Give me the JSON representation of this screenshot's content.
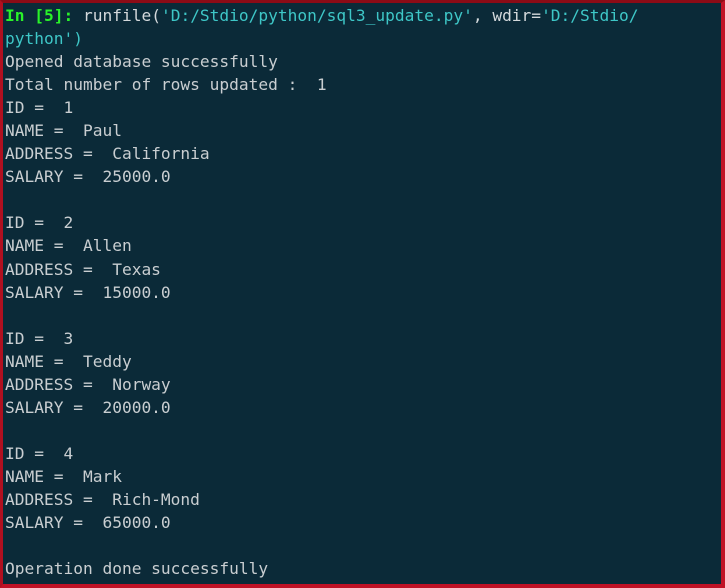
{
  "window": {
    "kind": "ipython-console",
    "background_color": "#0b2a38",
    "border_color": "#c01226",
    "output_text_color": "#c9ced1",
    "string_color": "#3ec7c7",
    "prompt_color": "#29f329",
    "code_color": "#d4d9dc"
  },
  "prompt": {
    "label_in": "In",
    "label_number": "[5]:",
    "full": "In [5]:"
  },
  "lines": [
    {
      "id": "line-input-1",
      "type": "input",
      "segments": [
        {
          "text": "In ",
          "color": "prompt"
        },
        {
          "text": "[5]:",
          "color": "prompt"
        },
        {
          "text": " runfile(",
          "color": "code"
        },
        {
          "text": "'D:/Stdio/python/sql3_update.py'",
          "color": "string"
        },
        {
          "text": ", wdir=",
          "color": "code"
        },
        {
          "text": "'D:/Stdio/",
          "color": "string"
        }
      ]
    },
    {
      "id": "line-input-2",
      "type": "input-wrap",
      "segments": [
        {
          "text": "python')",
          "color": "string"
        }
      ]
    },
    {
      "id": "line-out-1",
      "type": "output",
      "segments": [
        {
          "text": "Opened database successfully",
          "color": "output"
        }
      ]
    },
    {
      "id": "line-out-2",
      "type": "output",
      "segments": [
        {
          "text": "Total number of rows updated :  1",
          "color": "output"
        }
      ]
    },
    {
      "id": "line-r1-id",
      "type": "output",
      "segments": [
        {
          "text": "ID =  1",
          "color": "output"
        }
      ]
    },
    {
      "id": "line-r1-name",
      "type": "output",
      "segments": [
        {
          "text": "NAME =  Paul",
          "color": "output"
        }
      ]
    },
    {
      "id": "line-r1-address",
      "type": "output",
      "segments": [
        {
          "text": "ADDRESS =  California",
          "color": "output"
        }
      ]
    },
    {
      "id": "line-r1-salary",
      "type": "output",
      "segments": [
        {
          "text": "SALARY =  25000.0",
          "color": "output"
        }
      ]
    },
    {
      "id": "line-blank-1",
      "type": "blank",
      "segments": [
        {
          "text": " ",
          "color": "blank"
        }
      ]
    },
    {
      "id": "line-r2-id",
      "type": "output",
      "segments": [
        {
          "text": "ID =  2",
          "color": "output"
        }
      ]
    },
    {
      "id": "line-r2-name",
      "type": "output",
      "segments": [
        {
          "text": "NAME =  Allen",
          "color": "output"
        }
      ]
    },
    {
      "id": "line-r2-address",
      "type": "output",
      "segments": [
        {
          "text": "ADDRESS =  Texas",
          "color": "output"
        }
      ]
    },
    {
      "id": "line-r2-salary",
      "type": "output",
      "segments": [
        {
          "text": "SALARY =  15000.0",
          "color": "output"
        }
      ]
    },
    {
      "id": "line-blank-2",
      "type": "blank",
      "segments": [
        {
          "text": " ",
          "color": "blank"
        }
      ]
    },
    {
      "id": "line-r3-id",
      "type": "output",
      "segments": [
        {
          "text": "ID =  3",
          "color": "output"
        }
      ]
    },
    {
      "id": "line-r3-name",
      "type": "output",
      "segments": [
        {
          "text": "NAME =  Teddy",
          "color": "output"
        }
      ]
    },
    {
      "id": "line-r3-address",
      "type": "output",
      "segments": [
        {
          "text": "ADDRESS =  Norway",
          "color": "output"
        }
      ]
    },
    {
      "id": "line-r3-salary",
      "type": "output",
      "segments": [
        {
          "text": "SALARY =  20000.0",
          "color": "output"
        }
      ]
    },
    {
      "id": "line-blank-3",
      "type": "blank",
      "segments": [
        {
          "text": " ",
          "color": "blank"
        }
      ]
    },
    {
      "id": "line-r4-id",
      "type": "output",
      "segments": [
        {
          "text": "ID =  4",
          "color": "output"
        }
      ]
    },
    {
      "id": "line-r4-name",
      "type": "output",
      "segments": [
        {
          "text": "NAME =  Mark",
          "color": "output"
        }
      ]
    },
    {
      "id": "line-r4-address",
      "type": "output",
      "segments": [
        {
          "text": "ADDRESS =  Rich-Mond",
          "color": "output"
        }
      ]
    },
    {
      "id": "line-r4-salary",
      "type": "output",
      "segments": [
        {
          "text": "SALARY =  65000.0",
          "color": "output"
        }
      ]
    },
    {
      "id": "line-blank-4",
      "type": "blank",
      "segments": [
        {
          "text": " ",
          "color": "blank"
        }
      ]
    },
    {
      "id": "line-out-final",
      "type": "output",
      "segments": [
        {
          "text": "Operation done successfully",
          "color": "output"
        }
      ]
    }
  ],
  "records": [
    {
      "ID": "1",
      "NAME": "Paul",
      "ADDRESS": "California",
      "SALARY": "25000.0"
    },
    {
      "ID": "2",
      "NAME": "Allen",
      "ADDRESS": "Texas",
      "SALARY": "15000.0"
    },
    {
      "ID": "3",
      "NAME": "Teddy",
      "ADDRESS": "Norway",
      "SALARY": "20000.0"
    },
    {
      "ID": "4",
      "NAME": "Mark",
      "ADDRESS": "Rich-Mond",
      "SALARY": "65000.0"
    }
  ],
  "status": {
    "opened": "Opened database successfully",
    "rows_updated_label": "Total number of rows updated :",
    "rows_updated_count": "1",
    "done": "Operation done successfully"
  },
  "command": {
    "function": "runfile",
    "script_path": "D:/Stdio/python/sql3_update.py",
    "wdir": "D:/Stdio/python"
  }
}
